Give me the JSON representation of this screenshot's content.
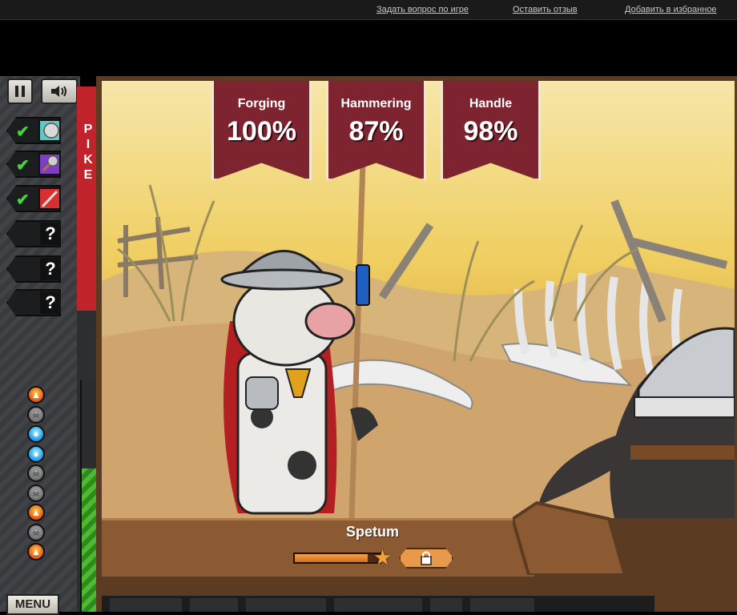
{
  "top_links": {
    "ask_question": "Задать вопрос по игре",
    "leave_review": "Оставить отзыв",
    "add_favorite": "Добавить в избранное"
  },
  "controls": {
    "pause_icon": "pause-icon",
    "sound_icon": "speaker-icon"
  },
  "weapon_type": {
    "letters": [
      "P",
      "I",
      "K",
      "E"
    ]
  },
  "parts": [
    {
      "status": "done",
      "icon": "shield-part-icon",
      "check": "✔"
    },
    {
      "status": "done",
      "icon": "mace-part-icon",
      "check": "✔"
    },
    {
      "status": "done",
      "icon": "spear-part-icon",
      "check": "✔"
    },
    {
      "status": "unknown",
      "label": "?"
    },
    {
      "status": "unknown",
      "label": "?"
    },
    {
      "status": "unknown",
      "label": "?"
    }
  ],
  "gems": [
    "fire",
    "skull",
    "water",
    "water",
    "skull",
    "skull",
    "fire",
    "skull",
    "fire"
  ],
  "quality_meter": {
    "level": 0.62
  },
  "menu": {
    "label": "MENU"
  },
  "stats": [
    {
      "label": "Forging",
      "value": "100%"
    },
    {
      "label": "Hammering",
      "value": "87%"
    },
    {
      "label": "Handle",
      "value": "98%"
    }
  ],
  "item": {
    "name": "Spetum",
    "progress": 0.86
  },
  "colors": {
    "banner": "#7e2430",
    "pike_strip": "#c0232a",
    "meter": "#4db935"
  }
}
